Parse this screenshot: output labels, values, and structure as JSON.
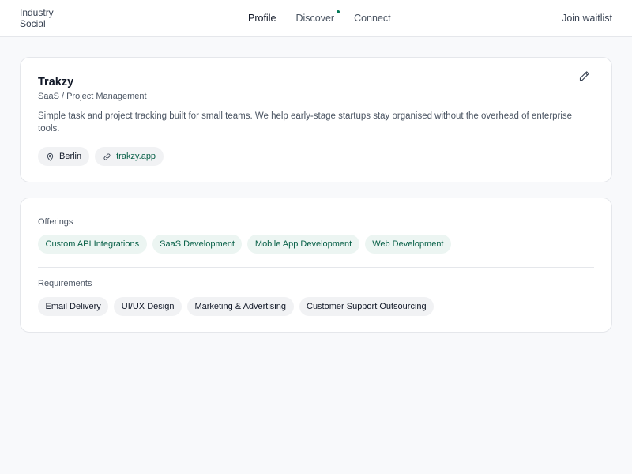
{
  "header": {
    "brand_line1": "Industry",
    "brand_line2": "Social",
    "nav": [
      {
        "label": "Profile",
        "active": true
      },
      {
        "label": "Discover",
        "active": false,
        "notification_dot": true
      },
      {
        "label": "Connect",
        "active": false
      }
    ],
    "cta_label": "Join waitlist"
  },
  "profile": {
    "name": "Trakzy",
    "category": "SaaS / Project Management",
    "description": "Simple task and project tracking built for small teams. We help early-stage startups stay organised without the overhead of enterprise tools.",
    "location": "Berlin",
    "website": "trakzy.app",
    "edit_icon": "pencil-icon"
  },
  "offerings": {
    "label": "Offerings",
    "items": [
      "Custom API Integrations",
      "SaaS Development",
      "Mobile App Development",
      "Web Development"
    ]
  },
  "requirements": {
    "label": "Requirements",
    "items": [
      "Email Delivery",
      "UI/UX Design",
      "Marketing & Advertising",
      "Customer Support Outsourcing"
    ]
  },
  "colors": {
    "accent": "#047857",
    "offer_tag_bg": "#ecf5f2",
    "offer_tag_text": "#065f46",
    "neutral_tag_bg": "#f1f2f4",
    "page_bg": "#f8f9fb"
  }
}
